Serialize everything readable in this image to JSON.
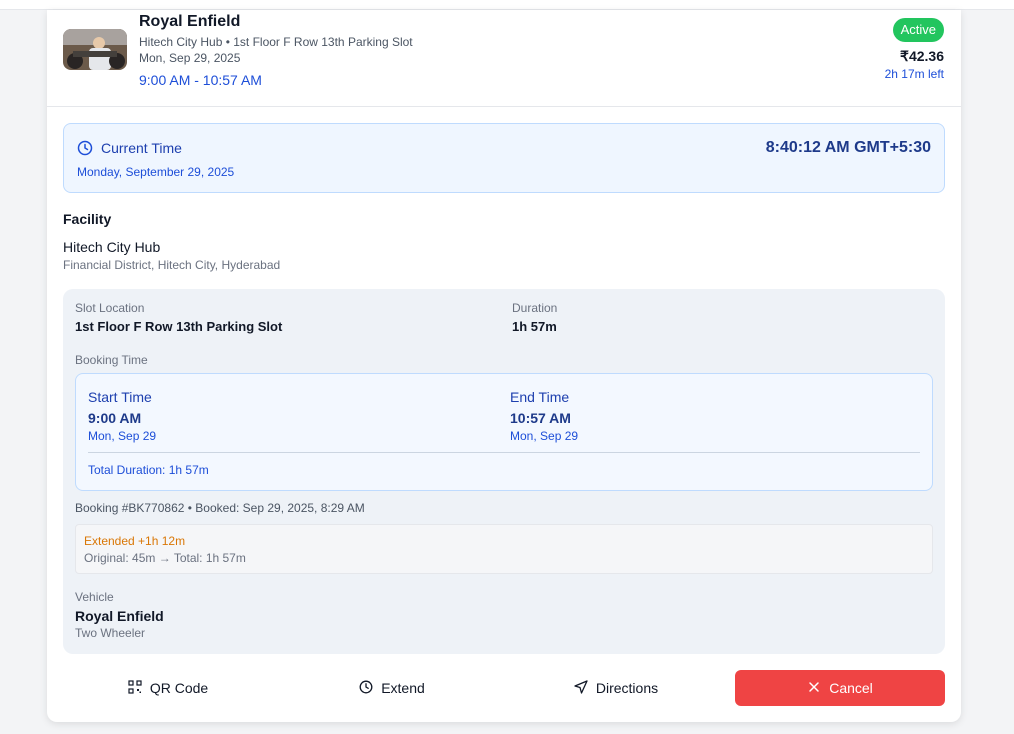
{
  "header": {
    "title": "Royal Enfield",
    "subtitle": "Hitech City Hub • 1st Floor F Row 13th Parking Slot",
    "date": "Mon, Sep 29, 2025",
    "time_range": "9:00 AM - 10:57 AM",
    "status": "Active",
    "price": "₹42.36",
    "time_left": "2h 17m left",
    "status_color": "#22c55e"
  },
  "current_time": {
    "label": "Current Time",
    "date": "Monday, September 29, 2025",
    "time": "8:40:12 AM GMT+5:30",
    "icon": "clock-icon"
  },
  "facility": {
    "heading": "Facility",
    "name": "Hitech City Hub",
    "address": "Financial District, Hitech City, Hyderabad"
  },
  "details": {
    "slot_label": "Slot Location",
    "slot_value": "1st Floor F Row 13th Parking Slot",
    "duration_label": "Duration",
    "duration_value": "1h 57m",
    "booking_time_label": "Booking Time",
    "start_label": "Start Time",
    "start_time": "9:00 AM",
    "start_date": "Mon, Sep 29",
    "end_label": "End Time",
    "end_time": "10:57 AM",
    "end_date": "Mon, Sep 29",
    "total_duration": "Total Duration: 1h 57m",
    "booking_meta": "Booking #BK770862 • Booked: Sep 29, 2025, 8:29 AM",
    "extended_label": "Extended +1h 12m",
    "extended_detail": "Original: 45m → Total: 1h 57m",
    "vehicle_label": "Vehicle",
    "vehicle_name": "Royal Enfield",
    "vehicle_type": "Two Wheeler"
  },
  "actions": {
    "qr": "QR Code",
    "extend": "Extend",
    "directions": "Directions",
    "cancel": "Cancel"
  },
  "colors": {
    "accent": "#1d4ed8",
    "cancel": "#ef4444",
    "extended": "#d97706"
  }
}
